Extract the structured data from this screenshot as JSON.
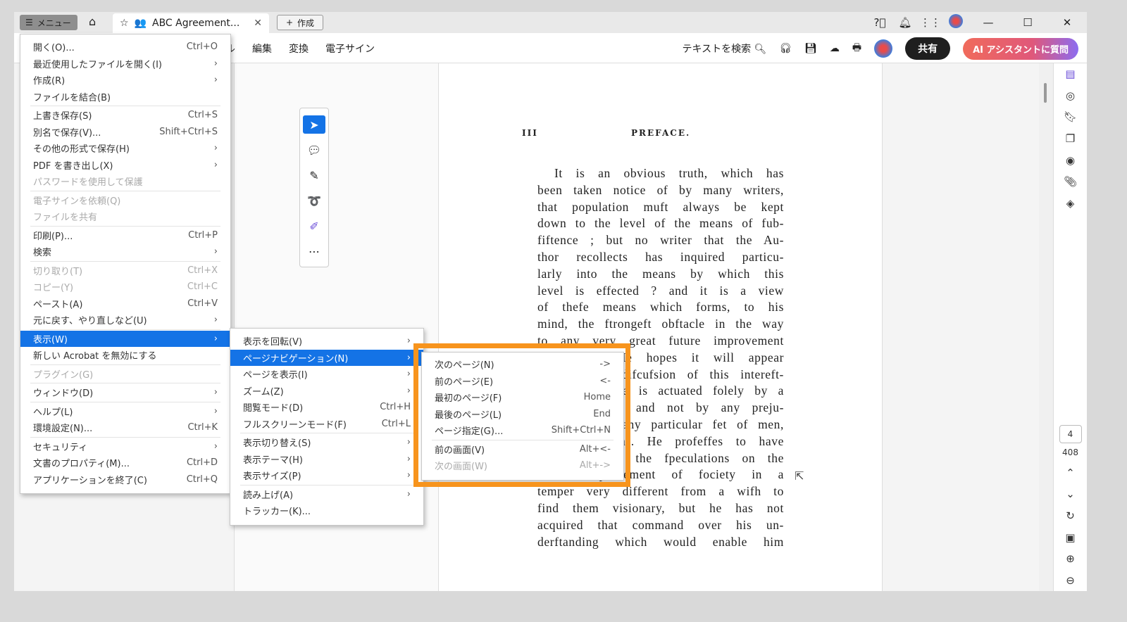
{
  "titlebar": {
    "menu_label": "メニュー",
    "tab_title": "ABC Agreement...",
    "create_label": "作成"
  },
  "toolbar": {
    "nav": [
      "ル",
      "編集",
      "変換",
      "電子サイン"
    ],
    "search_text": "テキストを検索",
    "share": "共有",
    "ai": "AI アシスタントに質問"
  },
  "floating_tools": [
    "select-icon",
    "comment-icon",
    "highlight-pen-icon",
    "lasso-icon",
    "ai-edit-icon",
    "more-icon"
  ],
  "page": {
    "page_no": "III",
    "title": "PREFACE.",
    "lines": [
      "It is an obvious truth, which has",
      "been taken notice of by many writers,",
      "that population muft always be kept",
      "down to the level of the means of fub-",
      "fiftence ; but no writer that the Au-",
      "thor recollects has inquired particu-",
      "larly into the means by which this",
      "level is effected ? and it is a view",
      "of thefe means which forms, to his",
      "mind, the ftrongeft obftacle in the way",
      "to any very great future improvement",
      "of fociety. He hopes it will appear",
      "that, in the difcufsion of this intereft-",
      "ing fubject, he is actuated folely by a",
      "love of truth, and not by any preju-",
      "dices againft any particular fet of men,",
      "or of opinions. He profeffes to have",
      "read fome of the fpeculations on the",
      "future improvement of fociety in a",
      "temper very different from a wifh to",
      "find them visionary, but he has not",
      "acquired that command over his un-",
      "derftanding which would enable him"
    ]
  },
  "sidebar": {
    "current_page": "4",
    "total_pages": "408"
  },
  "main_menu": [
    {
      "label": "開く(O)...",
      "shortcut": "Ctrl+O"
    },
    {
      "label": "最近使用したファイルを開く(I)",
      "submenu": true
    },
    {
      "label": "作成(R)",
      "submenu": true
    },
    {
      "label": "ファイルを結合(B)",
      "sep_after": true
    },
    {
      "label": "上書き保存(S)",
      "shortcut": "Ctrl+S"
    },
    {
      "label": "別名で保存(V)...",
      "shortcut": "Shift+Ctrl+S"
    },
    {
      "label": "その他の形式で保存(H)",
      "submenu": true
    },
    {
      "label": "PDF を書き出し(X)",
      "submenu": true
    },
    {
      "label": "パスワードを使用して保護",
      "disabled": true,
      "sep_after": true
    },
    {
      "label": "電子サインを依頼(Q)",
      "disabled": true
    },
    {
      "label": "ファイルを共有",
      "disabled": true,
      "sep_after": true
    },
    {
      "label": "印刷(P)...",
      "shortcut": "Ctrl+P"
    },
    {
      "label": "検索",
      "submenu": true,
      "sep_after": true
    },
    {
      "label": "切り取り(T)",
      "shortcut": "Ctrl+X",
      "disabled": true
    },
    {
      "label": "コピー(Y)",
      "shortcut": "Ctrl+C",
      "disabled": true
    },
    {
      "label": "ペースト(A)",
      "shortcut": "Ctrl+V"
    },
    {
      "label": "元に戻す、やり直しなど(U)",
      "submenu": true,
      "sep_after": true
    },
    {
      "label": "表示(W)",
      "submenu": true,
      "highlighted": true
    },
    {
      "label": "新しい Acrobat を無効にする",
      "sep_after": true
    },
    {
      "label": "プラグイン(G)",
      "disabled": true,
      "sep_after": true
    },
    {
      "label": "ウィンドウ(D)",
      "submenu": true,
      "sep_after": true
    },
    {
      "label": "ヘルプ(L)",
      "submenu": true
    },
    {
      "label": "環境設定(N)...",
      "shortcut": "Ctrl+K",
      "sep_after": true
    },
    {
      "label": "セキュリティ",
      "submenu": true
    },
    {
      "label": "文書のプロパティ(M)...",
      "shortcut": "Ctrl+D"
    },
    {
      "label": "アプリケーションを終了(C)",
      "shortcut": "Ctrl+Q"
    }
  ],
  "view_menu": [
    {
      "label": "表示を回転(V)",
      "submenu": true
    },
    {
      "label": "ページナビゲーション(N)",
      "submenu": true,
      "highlighted": true
    },
    {
      "label": "ページを表示(I)",
      "submenu": true
    },
    {
      "label": "ズーム(Z)",
      "submenu": true
    },
    {
      "label": "閲覧モード(D)",
      "shortcut": "Ctrl+H"
    },
    {
      "label": "フルスクリーンモード(F)",
      "shortcut": "Ctrl+L",
      "sep_after": true
    },
    {
      "label": "表示切り替え(S)",
      "submenu": true
    },
    {
      "label": "表示テーマ(H)",
      "submenu": true
    },
    {
      "label": "表示サイズ(P)",
      "submenu": true,
      "sep_after": true
    },
    {
      "label": "読み上げ(A)",
      "submenu": true
    },
    {
      "label": "トラッカー(K)..."
    }
  ],
  "nav_menu": [
    {
      "label": "次のページ(N)",
      "shortcut": "->"
    },
    {
      "label": "前のページ(E)",
      "shortcut": "<-"
    },
    {
      "label": "最初のページ(F)",
      "shortcut": "Home"
    },
    {
      "label": "最後のページ(L)",
      "shortcut": "End"
    },
    {
      "label": "ページ指定(G)...",
      "shortcut": "Shift+Ctrl+N",
      "sep_after": true
    },
    {
      "label": "前の画面(V)",
      "shortcut": "Alt+<-"
    },
    {
      "label": "次の画面(W)",
      "shortcut": "Alt+->",
      "disabled": true
    }
  ],
  "colors": {
    "accent": "#1473e6",
    "highlight_box": "#f7941d"
  }
}
